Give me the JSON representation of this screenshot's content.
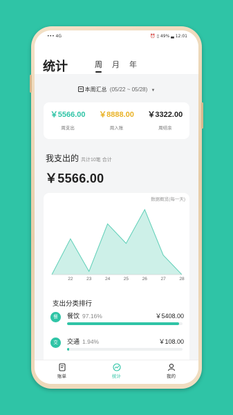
{
  "status_bar": {
    "left": "••• 4G",
    "right": "⏰ ▯ 49% ▃ 12:01"
  },
  "header": {
    "title": "统计",
    "tabs": [
      {
        "label": "周",
        "active": true
      },
      {
        "label": "月"
      },
      {
        "label": "年"
      }
    ]
  },
  "range": {
    "label": "本周汇总",
    "dates": "(05/22 ~ 05/28)"
  },
  "stats": [
    {
      "value": "￥5566.00",
      "label": "周支出",
      "color": "#2fc4a6"
    },
    {
      "value": "￥8888.00",
      "label": "周入账",
      "color": "#e9b226"
    },
    {
      "value": "￥3322.00",
      "label": "周结余",
      "color": "#222222"
    }
  ],
  "spend": {
    "title": "我支出的",
    "note": "共计10笔 合计",
    "amount": "￥5566.00"
  },
  "chart_note": "数据概览(每一天)",
  "chart_data": {
    "type": "area",
    "x": [
      "21",
      "22",
      "23",
      "24",
      "25",
      "26",
      "27",
      "28"
    ],
    "tick_labels": [
      "22",
      "23",
      "24",
      "25",
      "26",
      "27",
      "28"
    ],
    "values": [
      0.0,
      0.55,
      0.05,
      0.78,
      0.48,
      1.0,
      0.3,
      0.0
    ],
    "ylim": [
      0,
      1
    ],
    "line_color": "#5ecfb7",
    "fill_color": "#cdf0e8"
  },
  "rank": {
    "title": "支出分类排行",
    "items": [
      {
        "icon": "餐",
        "icon_name": "food-icon",
        "name": "餐饮",
        "pct": "97.16%",
        "amount": "￥5408.00",
        "fill": 0.9716
      },
      {
        "icon": "交",
        "icon_name": "transport-icon",
        "name": "交通",
        "pct": "1.94%",
        "amount": "￥108.00",
        "fill": 0.0194
      }
    ]
  },
  "nav": [
    {
      "label": "账单",
      "icon": "bill-icon"
    },
    {
      "label": "统计",
      "icon": "stats-icon",
      "active": true
    },
    {
      "label": "我的",
      "icon": "profile-icon"
    }
  ],
  "colors": {
    "accent": "#2fc4a6",
    "background": "#2fc4a6"
  }
}
